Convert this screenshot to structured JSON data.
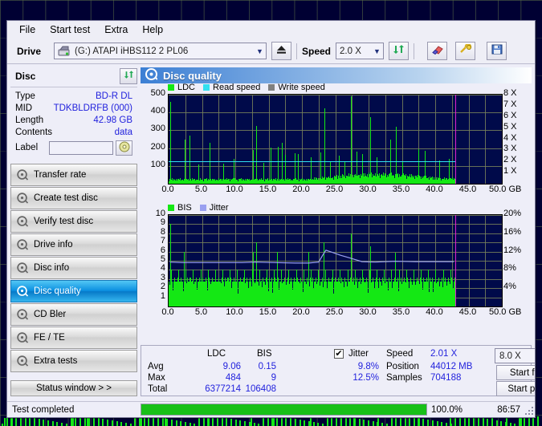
{
  "menu": {
    "items": [
      "File",
      "Start test",
      "Extra",
      "Help"
    ]
  },
  "toolbar": {
    "drive_label": "Drive",
    "drive_value": "(G:)  ATAPI iHBS112  2 PL06",
    "eject_icon": "eject-icon",
    "speed_label": "Speed",
    "speed_value": "2.0 X",
    "refresh_icon": "refresh-icon",
    "eraser_icon": "eraser-icon",
    "tools_icon": "tools-icon",
    "save_icon": "save-icon"
  },
  "disc": {
    "title": "Disc",
    "refresh_icon": "refresh-icon",
    "rows": [
      {
        "key": "Type",
        "value": "BD-R DL"
      },
      {
        "key": "MID",
        "value": "TDKBLDRFB (000)"
      },
      {
        "key": "Length",
        "value": "42.98 GB"
      },
      {
        "key": "Contents",
        "value": "data"
      }
    ],
    "label_key": "Label",
    "label_value": "",
    "label_placeholder": "",
    "label_icon": "disc-icon"
  },
  "nav": {
    "items": [
      {
        "label": "Transfer rate",
        "icon": "disc-icon",
        "active": false
      },
      {
        "label": "Create test disc",
        "icon": "disc-icon",
        "active": false
      },
      {
        "label": "Verify test disc",
        "icon": "disc-icon",
        "active": false
      },
      {
        "label": "Drive info",
        "icon": "disc-icon",
        "active": false
      },
      {
        "label": "Disc info",
        "icon": "disc-icon",
        "active": false
      },
      {
        "label": "Disc quality",
        "icon": "disc-icon",
        "active": true
      },
      {
        "label": "CD Bler",
        "icon": "disc-icon",
        "active": false
      },
      {
        "label": "FE / TE",
        "icon": "disc-icon",
        "active": false
      },
      {
        "label": "Extra tests",
        "icon": "disc-icon",
        "active": false
      }
    ],
    "status_window_label": "Status window > >"
  },
  "panel": {
    "title": "Disc quality",
    "icon": "disc-icon"
  },
  "results": {
    "col_ldc": "LDC",
    "col_bis": "BIS",
    "row_avg": "Avg",
    "row_max": "Max",
    "row_total": "Total",
    "ldc_avg": "9.06",
    "ldc_max": "484",
    "ldc_total": "6377214",
    "bis_avg": "0.15",
    "bis_max": "9",
    "bis_total": "106408",
    "jitter_label": "Jitter",
    "jitter_checked": "✔",
    "jitter_avg": "9.8%",
    "jitter_max": "12.5%",
    "speed_label": "Speed",
    "speed_value": "2.01 X",
    "position_label": "Position",
    "position_value": "44012 MB",
    "samples_label": "Samples",
    "samples_value": "704188",
    "speed_select": "8.0 X",
    "start_full": "Start full",
    "start_part": "Start part"
  },
  "status": {
    "text": "Test completed",
    "progress_pct": "100.0%",
    "progress_value": 100,
    "elapsed": "86:57"
  },
  "colors": {
    "ldc": "#14e814",
    "read_speed": "#30e0f0",
    "write_speed": "#808080",
    "bis": "#14e814",
    "jitter": "#9aa0f0",
    "plot_bg": "#000a4a",
    "marker": "#e020d0",
    "accent": "#0a8fe0"
  },
  "chart_data": [
    {
      "type": "bar",
      "name": "ldc-chart",
      "title": "",
      "legend": [
        {
          "label": "LDC",
          "color": "#14e814"
        },
        {
          "label": "Read speed",
          "color": "#30e0f0"
        },
        {
          "label": "Write speed",
          "color": "#808080"
        }
      ],
      "legend_position": "top-left",
      "xlabel": "GB",
      "ylabel": "",
      "xlim": [
        0,
        50
      ],
      "ylim": [
        0,
        500
      ],
      "y2lim": [
        0,
        8
      ],
      "y2_unit": "X",
      "yticks": [
        100,
        200,
        300,
        400,
        500
      ],
      "y2ticks": [
        1,
        2,
        3,
        4,
        5,
        6,
        7,
        8
      ],
      "xticks": [
        "0.0",
        "5.0",
        "10.0",
        "15.0",
        "20.0",
        "25.0",
        "30.0",
        "35.0",
        "40.0",
        "45.0",
        "50.0"
      ],
      "grid": true,
      "data_end_x": 43.0,
      "marker_x": 43.0,
      "read_speed_level": 2.01,
      "baseline": 22,
      "spikes": [
        {
          "x": 0.25,
          "y": 460
        },
        {
          "x": 2.4,
          "y": 248
        },
        {
          "x": 3.1,
          "y": 270
        },
        {
          "x": 4.4,
          "y": 110
        },
        {
          "x": 6.1,
          "y": 232
        },
        {
          "x": 8.2,
          "y": 112
        },
        {
          "x": 9.8,
          "y": 138
        },
        {
          "x": 12.7,
          "y": 190
        },
        {
          "x": 13.1,
          "y": 325
        },
        {
          "x": 14.2,
          "y": 118
        },
        {
          "x": 15.3,
          "y": 205
        },
        {
          "x": 16.4,
          "y": 208
        },
        {
          "x": 17.0,
          "y": 228
        },
        {
          "x": 17.5,
          "y": 160
        },
        {
          "x": 18.9,
          "y": 170
        },
        {
          "x": 19.4,
          "y": 166
        },
        {
          "x": 21.3,
          "y": 147
        },
        {
          "x": 22.8,
          "y": 175
        },
        {
          "x": 23.4,
          "y": 424
        },
        {
          "x": 24.2,
          "y": 125
        },
        {
          "x": 25.6,
          "y": 158
        },
        {
          "x": 26.4,
          "y": 120
        },
        {
          "x": 27.4,
          "y": 490
        },
        {
          "x": 28.2,
          "y": 180
        },
        {
          "x": 29.0,
          "y": 165
        },
        {
          "x": 30.3,
          "y": 375
        },
        {
          "x": 31.2,
          "y": 150
        },
        {
          "x": 33.3,
          "y": 250
        },
        {
          "x": 34.1,
          "y": 320
        },
        {
          "x": 35.1,
          "y": 120
        },
        {
          "x": 37.5,
          "y": 195
        },
        {
          "x": 38.4,
          "y": 185
        },
        {
          "x": 40.6,
          "y": 130
        },
        {
          "x": 42.1,
          "y": 140
        }
      ]
    },
    {
      "type": "bar",
      "name": "bis-jitter-chart",
      "title": "",
      "legend": [
        {
          "label": "BIS",
          "color": "#14e814"
        },
        {
          "label": "Jitter",
          "color": "#9aa0f0"
        }
      ],
      "legend_position": "top-left",
      "xlabel": "GB",
      "ylabel": "",
      "xlim": [
        0,
        50
      ],
      "ylim": [
        0,
        10
      ],
      "y2lim": [
        0,
        20
      ],
      "y2_unit": "%",
      "yticks": [
        1,
        2,
        3,
        4,
        5,
        6,
        7,
        8,
        9,
        10
      ],
      "y2ticks": [
        "4%",
        "8%",
        "12%",
        "16%",
        "20%"
      ],
      "xticks": [
        "0.0",
        "5.0",
        "10.0",
        "15.0",
        "20.0",
        "25.0",
        "30.0",
        "35.0",
        "40.0",
        "45.0",
        "50.0"
      ],
      "grid": true,
      "data_end_x": 43.0,
      "marker_x": 43.0,
      "baseline": 2,
      "jitter_avg_pct": 9.8,
      "jitter_series": [
        {
          "x": 0.2,
          "y": 9.7
        },
        {
          "x": 2.0,
          "y": 9.6
        },
        {
          "x": 5.0,
          "y": 9.6
        },
        {
          "x": 8.0,
          "y": 9.6
        },
        {
          "x": 11.0,
          "y": 9.6
        },
        {
          "x": 13.0,
          "y": 9.7
        },
        {
          "x": 16.0,
          "y": 9.6
        },
        {
          "x": 19.0,
          "y": 9.5
        },
        {
          "x": 21.0,
          "y": 9.5
        },
        {
          "x": 22.5,
          "y": 9.7
        },
        {
          "x": 23.2,
          "y": 11.4
        },
        {
          "x": 23.6,
          "y": 12.3
        },
        {
          "x": 24.6,
          "y": 11.8
        },
        {
          "x": 25.8,
          "y": 11.2
        },
        {
          "x": 27.2,
          "y": 10.6
        },
        {
          "x": 29.0,
          "y": 9.8
        },
        {
          "x": 31.0,
          "y": 9.7
        },
        {
          "x": 34.0,
          "y": 9.9
        },
        {
          "x": 37.0,
          "y": 9.8
        },
        {
          "x": 40.0,
          "y": 9.8
        },
        {
          "x": 42.8,
          "y": 9.8
        }
      ],
      "spikes": [
        {
          "x": 0.25,
          "y": 9.0
        },
        {
          "x": 2.3,
          "y": 6.0
        },
        {
          "x": 12.7,
          "y": 6.0
        },
        {
          "x": 13.1,
          "y": 7.0
        },
        {
          "x": 16.3,
          "y": 6.0
        },
        {
          "x": 21.0,
          "y": 6.0
        },
        {
          "x": 23.3,
          "y": 7.0
        },
        {
          "x": 27.4,
          "y": 8.0
        },
        {
          "x": 30.3,
          "y": 6.6
        },
        {
          "x": 34.0,
          "y": 5.9
        }
      ]
    }
  ]
}
